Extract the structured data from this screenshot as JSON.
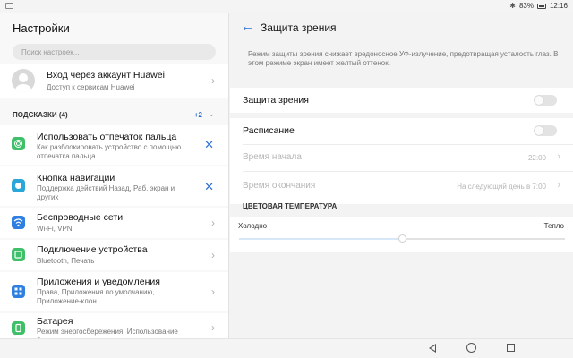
{
  "status_bar": {
    "battery": "83%",
    "time": "12:16",
    "icons": [
      "bluetooth-icon",
      "battery-icon"
    ]
  },
  "left_panel": {
    "title": "Настройки",
    "search_placeholder": "Поиск настроек...",
    "account": {
      "title": "Вход через аккаунт Huawei",
      "subtitle": "Доступ к сервисам Huawei"
    },
    "hints": {
      "label": "ПОДСКАЗКИ (4)",
      "count": "+2"
    },
    "suggestions": [
      {
        "title": "Использовать отпечаток пальца",
        "subtitle": "Как разблокировать устройство с помощью отпечатка пальца",
        "icon": "fingerprint-icon",
        "color": "#3fbf6a"
      },
      {
        "title": "Кнопка навигации",
        "subtitle": "Поддержка действий Назад, Раб. экран и других",
        "icon": "navigation-dock-icon",
        "color": "#2aa7d8"
      }
    ],
    "items": [
      {
        "title": "Беспроводные сети",
        "subtitle": "Wi-Fi, VPN",
        "icon": "wifi-icon",
        "color": "#2f7fe0"
      },
      {
        "title": "Подключение устройства",
        "subtitle": "Bluetooth, Печать",
        "icon": "device-connection-icon",
        "color": "#3fbf6a"
      },
      {
        "title": "Приложения и уведомления",
        "subtitle": "Права, Приложения по умолчанию, Приложение-клон",
        "icon": "apps-icon",
        "color": "#2f7fe0"
      },
      {
        "title": "Батарея",
        "subtitle": "Режим энергосбережения, Использование батареи",
        "icon": "battery-icon",
        "color": "#3fbf6a"
      }
    ]
  },
  "right_panel": {
    "title": "Защита зрения",
    "description": "Режим защиты зрения снижает вредоносное УФ-излучение, предотвращая усталость глаз. В этом режиме экран имеет желтый оттенок.",
    "eye_protection": {
      "label": "Защита зрения",
      "enabled": false
    },
    "schedule": {
      "label": "Расписание",
      "enabled": false
    },
    "start_time": {
      "label": "Время начала",
      "value": "22:00"
    },
    "end_time": {
      "label": "Время окончания",
      "value": "На следующий день в 7:00"
    },
    "color_temperature": {
      "label": "ЦВЕТОВАЯ ТЕМПЕРАТУРА",
      "cold": "Холодно",
      "warm": "Тепло",
      "level": 0.5
    }
  },
  "navbar": {
    "icons": [
      "back-icon",
      "home-icon",
      "recent-apps-icon"
    ]
  },
  "colors": {
    "accent": "#2b6fd6",
    "green": "#3fbf6a",
    "blue": "#2f7fe0"
  }
}
